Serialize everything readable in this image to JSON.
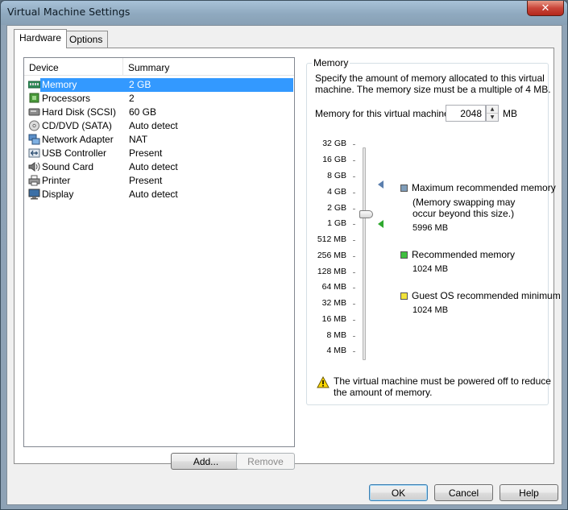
{
  "window": {
    "title": "Virtual Machine Settings",
    "close_glyph": "✕"
  },
  "tabs": [
    {
      "label": "Hardware",
      "active": true
    },
    {
      "label": "Options",
      "active": false
    }
  ],
  "device_list": {
    "headers": {
      "device": "Device",
      "summary": "Summary"
    },
    "rows": [
      {
        "name": "Memory",
        "summary": "2 GB",
        "icon": "memory-icon",
        "selected": true
      },
      {
        "name": "Processors",
        "summary": "2",
        "icon": "processor-icon",
        "selected": false
      },
      {
        "name": "Hard Disk (SCSI)",
        "summary": "60 GB",
        "icon": "hard-disk-icon",
        "selected": false
      },
      {
        "name": "CD/DVD (SATA)",
        "summary": "Auto detect",
        "icon": "cd-dvd-icon",
        "selected": false
      },
      {
        "name": "Network Adapter",
        "summary": "NAT",
        "icon": "network-adapter-icon",
        "selected": false
      },
      {
        "name": "USB Controller",
        "summary": "Present",
        "icon": "usb-icon",
        "selected": false
      },
      {
        "name": "Sound Card",
        "summary": "Auto detect",
        "icon": "sound-card-icon",
        "selected": false
      },
      {
        "name": "Printer",
        "summary": "Present",
        "icon": "printer-icon",
        "selected": false
      },
      {
        "name": "Display",
        "summary": "Auto detect",
        "icon": "display-icon",
        "selected": false
      }
    ],
    "add_label": "Add...",
    "remove_label": "Remove"
  },
  "memory": {
    "group_title": "Memory",
    "description_line1": "Specify the amount of memory allocated to this virtual",
    "description_line2": "machine. The memory size must be a multiple of 4 MB.",
    "field_label": "Memory for this virtual machine:",
    "value": "2048",
    "unit": "MB",
    "scale_ticks": [
      "32 GB",
      "16 GB",
      "8 GB",
      "4 GB",
      "2 GB",
      "1 GB",
      "512 MB",
      "256 MB",
      "128 MB",
      "64 MB",
      "32 MB",
      "16 MB",
      "8 MB",
      "4 MB"
    ],
    "slider_value_label": "2 GB",
    "legend": {
      "max": {
        "label": "Maximum recommended memory",
        "note1": "(Memory swapping may",
        "note2": "occur beyond this size.)",
        "value": "5996 MB",
        "color": "#7f9db9"
      },
      "recommended": {
        "label": "Recommended memory",
        "value": "1024 MB",
        "color": "#3fbf3f"
      },
      "guest_min": {
        "label": "Guest OS recommended minimum",
        "value": "1024 MB",
        "color": "#f2e33a"
      }
    },
    "warning_line1": "The virtual machine must be powered off to reduce",
    "warning_line2": "the amount of memory."
  },
  "footer": {
    "ok_label": "OK",
    "cancel_label": "Cancel",
    "help_label": "Help"
  }
}
